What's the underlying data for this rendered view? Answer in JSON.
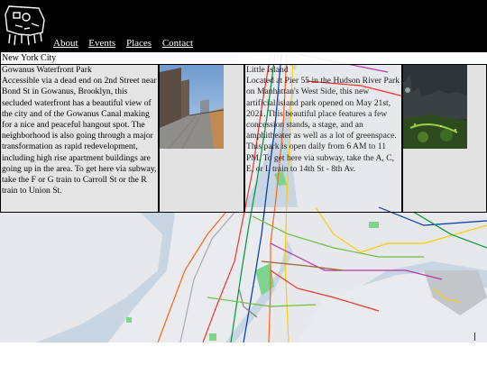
{
  "site": {
    "logo": "site-logo"
  },
  "nav": [
    "About",
    "Events",
    "Places",
    "Contact"
  ],
  "city": "New York City",
  "cards": [
    {
      "title": "Gowanus Waterfront Park",
      "text": "Accessible via a dead end on 2nd Street near Bond St in Gowanus, Brooklyn, this secluded waterfront has a beautiful view of the city and of the Gowanus Canal making for a nice and peaceful hangout spot. The neighborhood is also going through a major transformation as rapid redevelopment, including high rise apartment buildings are going up in the area. To get here via subway, take the F or G train to Carroll St or the R train to Union St.",
      "image": "waterfront-walkway-photo"
    },
    {
      "title": "Little Island",
      "text": "Located at Pier 55 in the Hudson River Park on Manhattan's West Side, this new artificial island park opened on May 21st, 2021. This beautiful place features a few concession stands, a stage, and an amphitheater as well as a lot of greenspace. This park is open daily from 6 AM to 11 PM. To get here via subway, take the A, C, E, or L train to 14th St - 8th Av.",
      "image": "little-island-night-photo"
    }
  ],
  "colors": {
    "header_bg": "#000000",
    "card_bg": "#e5e5e5",
    "map_land": "#e8eaed",
    "map_water": "#c5d4e0",
    "park": "#7fd48d"
  }
}
